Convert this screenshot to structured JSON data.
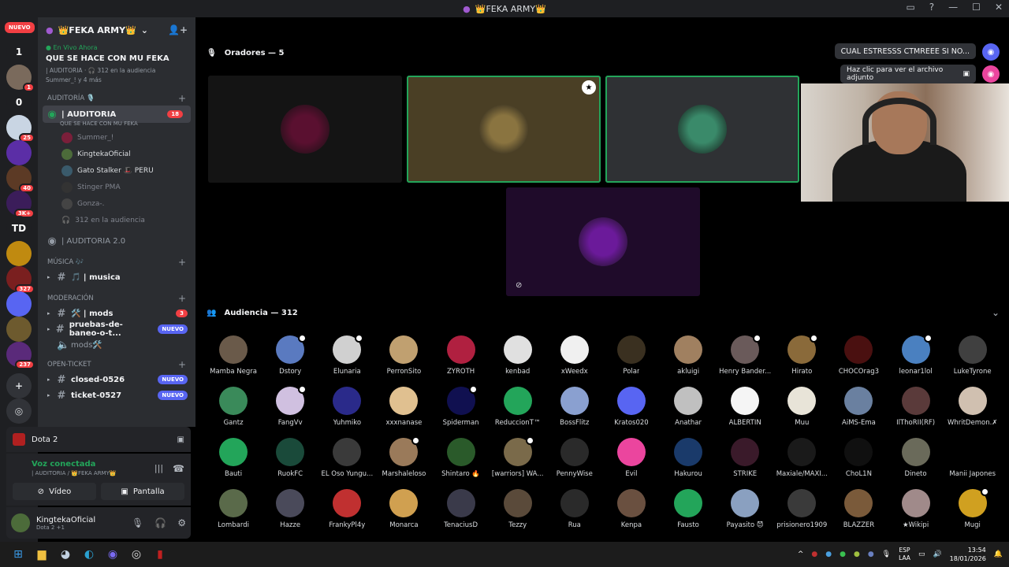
{
  "window": {
    "title": "👑FEKA ARMY👑"
  },
  "server_rail": {
    "nuevo_label": "NUEVO",
    "items": [
      {
        "label": "1",
        "color": "#1e1f22"
      },
      {
        "label": "",
        "color": "#7a6a5c",
        "badge": "1"
      },
      {
        "label": "0",
        "color": "#1e1f22"
      },
      {
        "label": "",
        "color": "#c9d5e3",
        "badge": "25"
      },
      {
        "label": "",
        "color": "#5b2ea6"
      },
      {
        "label": "",
        "color": "#5c3a25",
        "badge": "40"
      },
      {
        "label": "",
        "color": "#3b1d5a",
        "badge": "3K+"
      },
      {
        "label": "TD",
        "color": "#1e1f22"
      },
      {
        "label": "",
        "color": "#c08a10"
      },
      {
        "label": "",
        "color": "#7a1f1f",
        "badge": "327"
      },
      {
        "label": "",
        "color": "#5865f2"
      },
      {
        "label": "",
        "color": "#6d5a2e"
      },
      {
        "label": "",
        "color": "#5a2a7a",
        "badge": "237"
      }
    ]
  },
  "guild": {
    "name": "👑FEKA ARMY👑",
    "live_tag": "En Vivo Ahora",
    "live_title": "QUE SE HACE CON MU FEKA",
    "live_sub": "| AUDITORIA · 🎧 312 en la audiencia",
    "live_sub2": "Summer_! y 4 más"
  },
  "channels": {
    "cat_auditoria": "AUDITORÍA 🎙️",
    "active_channel": "| AUDITORIA",
    "active_badge": "18",
    "active_topic": "QUE SE HACE CON MU FEKA",
    "voice_users": [
      {
        "name": "Summer_!",
        "muted": true,
        "color": "#7a1f3a"
      },
      {
        "name": "KingtekaOficial",
        "muted": false,
        "color": "#4c6b3a"
      },
      {
        "name": "Gato Stalker 🎩 PERU",
        "muted": false,
        "color": "#3a5a6b"
      },
      {
        "name": "Stinger PMA",
        "muted": true,
        "color": "#333"
      },
      {
        "name": "Gonza-.",
        "muted": true,
        "color": "#444"
      }
    ],
    "audience_line": "312 en la audiencia",
    "auditoria2": "| AUDITORIA 2.0",
    "cat_musica": "MÚSICA 🎶",
    "musica": "🎵 | musica",
    "cat_moderacion": "MODERACIÓN",
    "mods": "🛠️ | mods",
    "mods_badge": "3",
    "pruebas": "pruebas-de-baneo-o-t...",
    "mods2": "mods🛠️",
    "cat_ticket": "OPEN-TICKET",
    "closed": "closed-0526",
    "ticket": "ticket-0527",
    "nuevo": "NUEVO"
  },
  "activity": {
    "label": "Dota 2"
  },
  "voice": {
    "status": "Voz conectada",
    "location": "| AUDITORIA / 👑FEKA ARMY👑",
    "video_label": "Vídeo",
    "screen_label": "Pantalla"
  },
  "user": {
    "name": "KingtekaOficial",
    "status": "Dota 2 +1"
  },
  "stage": {
    "speakers_label": "Oradores — 5",
    "audience_label": "Audiencia — 312",
    "speakers": [
      {
        "name": "Summer_!",
        "bg": "#141414",
        "av": "#5a1030",
        "speaking": false
      },
      {
        "name": "KingtekaOficial",
        "bg": "#4a3f25",
        "av": "#8a7440",
        "speaking": true
      },
      {
        "name": "Gato Stalker",
        "bg": "#2f3134",
        "av": "#3a8a6a",
        "speaking": true
      },
      {
        "name": "Stinger PMA",
        "bg": "#1f0b2a",
        "av": "#6b1a9a",
        "speaking": false
      }
    ]
  },
  "notifications": {
    "msg1": "CUAL ESTRESSS CTMREEE SI NO...",
    "msg2": "Haz clic para ver el archivo adjunto"
  },
  "audience": [
    {
      "name": "Mamba Negra",
      "color": "#6a5a4a",
      "stream": false
    },
    {
      "name": "Dstory",
      "color": "#5a7ac0",
      "stream": true
    },
    {
      "name": "Elunaria",
      "color": "#d0d0d0",
      "stream": true
    },
    {
      "name": "PerronSito",
      "color": "#c0a070",
      "stream": false
    },
    {
      "name": "ZYROTH",
      "color": "#b02040",
      "stream": false
    },
    {
      "name": "kenbad",
      "color": "#e0e0e0",
      "stream": false
    },
    {
      "name": "xWeedx",
      "color": "#f0f0f0",
      "stream": false
    },
    {
      "name": "Polar",
      "color": "#3a3020",
      "stream": false
    },
    {
      "name": "akluigi",
      "color": "#a08060",
      "stream": false
    },
    {
      "name": "Henry Bander...",
      "color": "#6a5a5a",
      "stream": true
    },
    {
      "name": "Hirato",
      "color": "#8a6a3a",
      "stream": true
    },
    {
      "name": "CHOCOrag3",
      "color": "#4a1010",
      "stream": false
    },
    {
      "name": "leonar1lol",
      "color": "#4a80c0",
      "stream": true
    },
    {
      "name": "LukeTyrone",
      "color": "#404040",
      "stream": false
    },
    {
      "name": "Gantz",
      "color": "#3a8a5a",
      "stream": false
    },
    {
      "name": "FangVv",
      "color": "#d0c0e0",
      "stream": true
    },
    {
      "name": "Yuhmiko",
      "color": "#2a2a8a",
      "stream": false
    },
    {
      "name": "xxxnanase",
      "color": "#e0c090",
      "stream": false
    },
    {
      "name": "Spiderman",
      "color": "#101050",
      "stream": true
    },
    {
      "name": "ReduccionT™",
      "color": "#23a55a",
      "stream": false
    },
    {
      "name": "BossFlitz",
      "color": "#8aa0d0",
      "stream": false
    },
    {
      "name": "Kratos020",
      "color": "#5865f2",
      "stream": false
    },
    {
      "name": "Anathar",
      "color": "#c0c0c0",
      "stream": false
    },
    {
      "name": "ALBERTIN",
      "color": "#f5f5f5",
      "stream": false
    },
    {
      "name": "Muu",
      "color": "#e8e4d8",
      "stream": false
    },
    {
      "name": "AiMS-Ema",
      "color": "#6a80a0",
      "stream": false
    },
    {
      "name": "IlThoRII(RF)",
      "color": "#5a3a3a",
      "stream": false
    },
    {
      "name": "WhritDemon.✗",
      "color": "#d0c0b0",
      "stream": false
    },
    {
      "name": "Bauti",
      "color": "#23a55a",
      "stream": false
    },
    {
      "name": "RuokFC",
      "color": "#1a4a3a",
      "stream": false
    },
    {
      "name": "EL Oso Yungu...",
      "color": "#3a3a3a",
      "stream": false
    },
    {
      "name": "Marshaleloso",
      "color": "#9a7a5a",
      "stream": true
    },
    {
      "name": "Shintaro 🔥",
      "color": "#2a5a2a",
      "stream": false
    },
    {
      "name": "[warriors] WA...",
      "color": "#7a6a4a",
      "stream": true
    },
    {
      "name": "PennyWise",
      "color": "#2a2a2a",
      "stream": false
    },
    {
      "name": "Evil",
      "color": "#eb459e",
      "stream": false
    },
    {
      "name": "Hakurou",
      "color": "#1a3a6a",
      "stream": false
    },
    {
      "name": "STRIKE",
      "color": "#3a1a2a",
      "stream": false
    },
    {
      "name": "Maxiale/MAXI...",
      "color": "#1a1a1a",
      "stream": false
    },
    {
      "name": "ChoL1N",
      "color": "#101010",
      "stream": false
    },
    {
      "name": "Dineto",
      "color": "#6a6a5a",
      "stream": false
    },
    {
      "name": "Manii Japones",
      "color": "#000000",
      "stream": false
    },
    {
      "name": "Lombardi",
      "color": "#5a6a4a",
      "stream": false
    },
    {
      "name": "Hazze",
      "color": "#4a4a5a",
      "stream": false
    },
    {
      "name": "FrankyPl4y",
      "color": "#c03030",
      "stream": false
    },
    {
      "name": "Monarca",
      "color": "#d0a050",
      "stream": false
    },
    {
      "name": "TenaciusD",
      "color": "#3a3a4a",
      "stream": false
    },
    {
      "name": "Tezzy",
      "color": "#5a4a3a",
      "stream": false
    },
    {
      "name": "Rua",
      "color": "#2a2a2a",
      "stream": false
    },
    {
      "name": "Kenpa",
      "color": "#6a5040",
      "stream": false
    },
    {
      "name": "Fausto",
      "color": "#23a55a",
      "stream": false
    },
    {
      "name": "Payasito 😈",
      "color": "#8aa0c0",
      "stream": false
    },
    {
      "name": "prisionero1909",
      "color": "#3a3a3a",
      "stream": false
    },
    {
      "name": "BLAZZER",
      "color": "#7a5a3a",
      "stream": false
    },
    {
      "name": "★Wikipi",
      "color": "#a08a8a",
      "stream": false
    },
    {
      "name": "Mugi",
      "color": "#d0a020",
      "stream": true
    }
  ],
  "taskbar": {
    "lang_top": "ESP",
    "lang_bottom": "LAA",
    "time": "13:54",
    "date": "18/01/2026"
  }
}
